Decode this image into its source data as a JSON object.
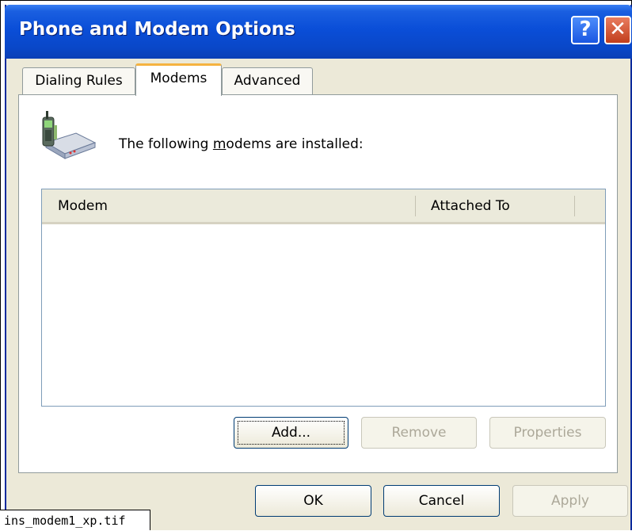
{
  "window": {
    "title": "Phone and Modem Options",
    "help_symbol": "?",
    "close_symbol": "✕"
  },
  "tabs": [
    {
      "label": "Dialing Rules",
      "selected": false
    },
    {
      "label": "Modems",
      "selected": true
    },
    {
      "label": "Advanced",
      "selected": false
    }
  ],
  "modems_tab": {
    "icon": "phone-modem-icon",
    "intro_prefix": "The following ",
    "intro_underlined": "m",
    "intro_suffix": "odems are  installed:",
    "list": {
      "columns": [
        "Modem",
        "Attached To"
      ],
      "rows": []
    },
    "buttons": {
      "add": "Add...",
      "remove": "Remove",
      "properties": "Properties"
    }
  },
  "footer_buttons": {
    "ok": "OK",
    "cancel": "Cancel",
    "apply": "Apply"
  },
  "caption": "ins_modem1_xp.tif",
  "colors": {
    "titlebar": "#0a4ed8",
    "dialog_face": "#ece9d8",
    "tab_highlight": "#f5b340",
    "close_button": "#c13e1c"
  }
}
